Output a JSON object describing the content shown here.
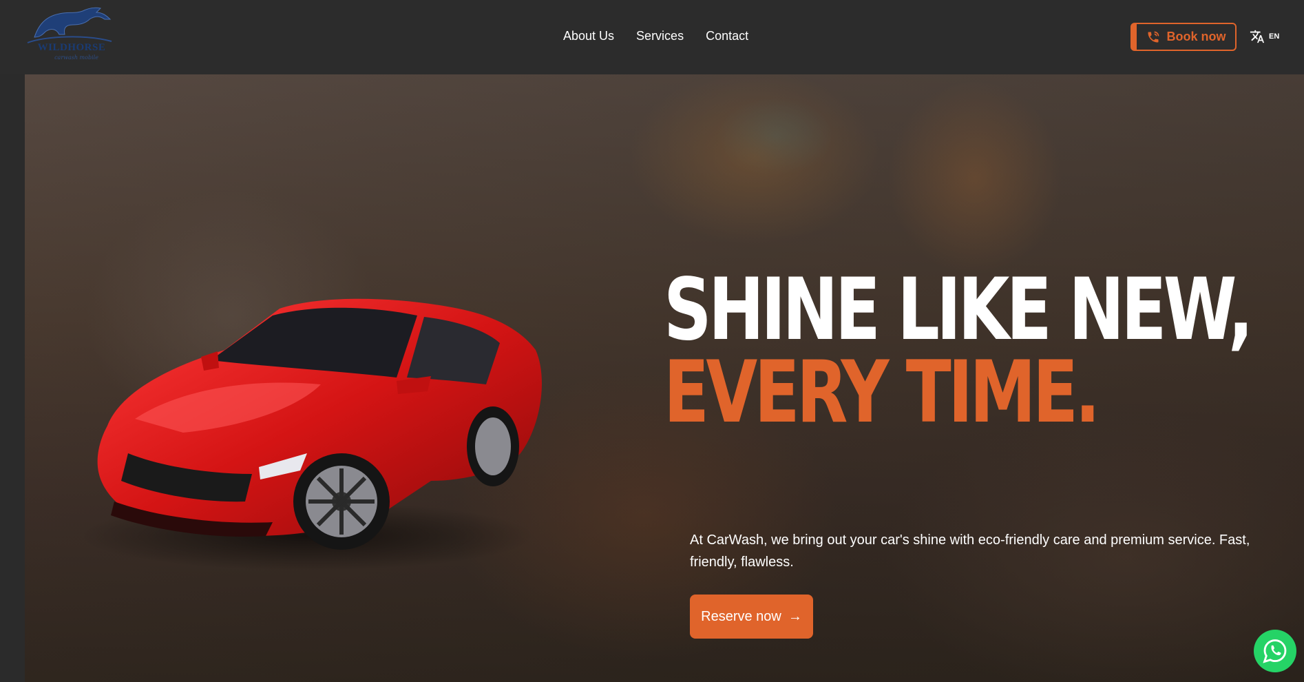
{
  "header": {
    "logo_text": "WILDHORSE",
    "logo_tagline": "carwash mobile",
    "nav": [
      "About Us",
      "Services",
      "Contact"
    ],
    "book_label": "Book now",
    "lang_label": "EN"
  },
  "hero": {
    "headline_line1": "SHINE LIKE NEW,",
    "headline_line2": "EVERY TIME.",
    "description": "At CarWash, we bring out your car's shine with eco-friendly care and premium service. Fast, friendly, flawless.",
    "reserve_label": "Reserve now",
    "reserve_arrow": "→"
  },
  "colors": {
    "accent": "#e0642b",
    "header_bg": "#2c2c2c",
    "whatsapp": "#25d366"
  },
  "icons": {
    "phone": "phone-icon",
    "language": "translate-icon",
    "whatsapp": "whatsapp-icon",
    "logo": "horse-logo"
  }
}
